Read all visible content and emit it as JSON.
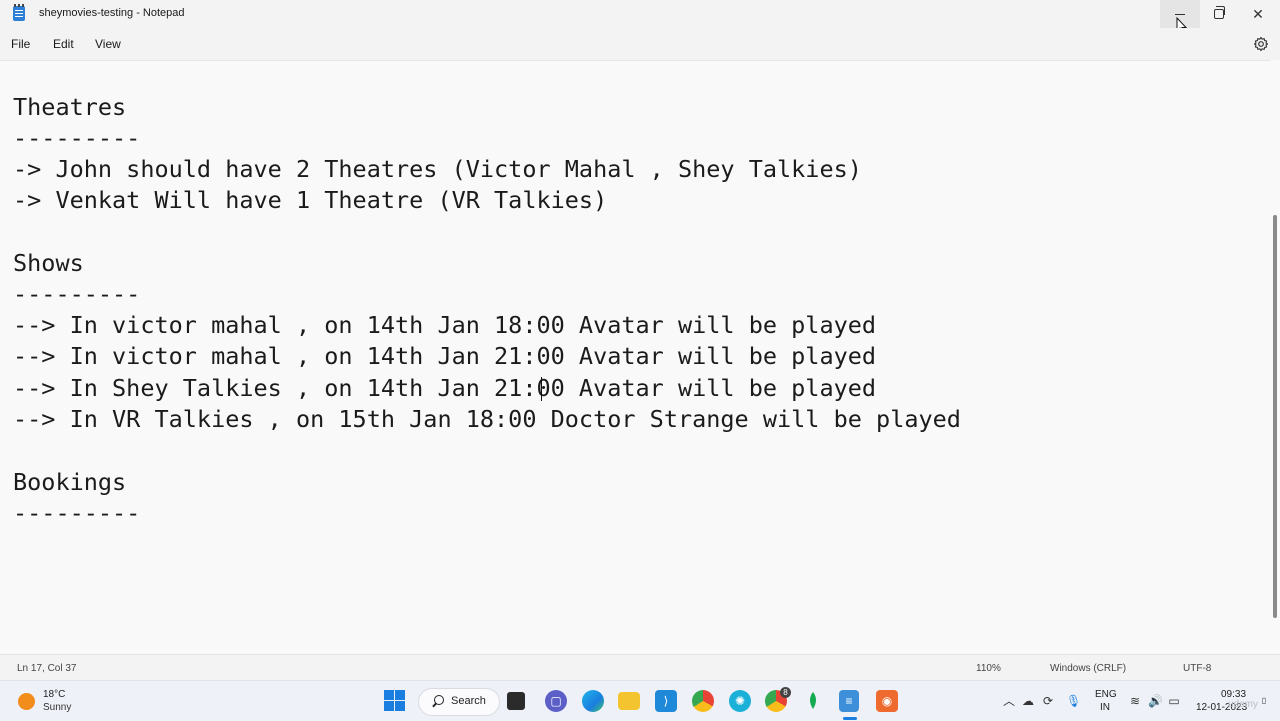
{
  "window": {
    "title": "sheymovies-testing - Notepad",
    "minimize_glyph": "—",
    "close_glyph": "✕"
  },
  "menu": {
    "items": [
      {
        "label": "File"
      },
      {
        "label": "Edit"
      },
      {
        "label": "View"
      }
    ],
    "settings_icon": "gear-icon"
  },
  "editor": {
    "lines": [
      "Theatres",
      "---------",
      "-> John should have 2 Theatres (Victor Mahal , Shey Talkies)",
      "-> Venkat Will have 1 Theatre (VR Talkies)",
      "",
      "Shows",
      "---------",
      "--> In victor mahal , on 14th Jan 18:00 Avatar will be played",
      "--> In victor mahal , on 14th Jan 21:00 Avatar will be played",
      "--> In Shey Talkies , on 14th Jan 21:00 Avatar will be played",
      "--> In VR Talkies , on 15th Jan 18:00 Doctor Strange will be played",
      "",
      "Bookings",
      "---------"
    ]
  },
  "statusbar": {
    "position": "Ln 17, Col 37",
    "zoom": "110%",
    "line_ending": "Windows (CRLF)",
    "encoding": "UTF-8"
  },
  "taskbar": {
    "weather_temp": "18°C",
    "weather_desc": "Sunny",
    "search_label": "Search",
    "apps": [
      "start-icon",
      "task-view-icon",
      "meet-icon",
      "edge-icon",
      "file-explorer-icon",
      "vscode-icon",
      "chrome-icon",
      "bitdefender-icon",
      "chrome-profile-icon",
      "mongodb-icon",
      "notepad-icon",
      "postman-icon"
    ],
    "chrome_badge": "8",
    "lang_top": "ENG",
    "lang_bottom": "IN",
    "time": "09:33",
    "date": "12-01-2023",
    "watermark": "udemy"
  },
  "colors": {
    "accent": "#1a7ee0",
    "weather": "#f28c1a"
  }
}
